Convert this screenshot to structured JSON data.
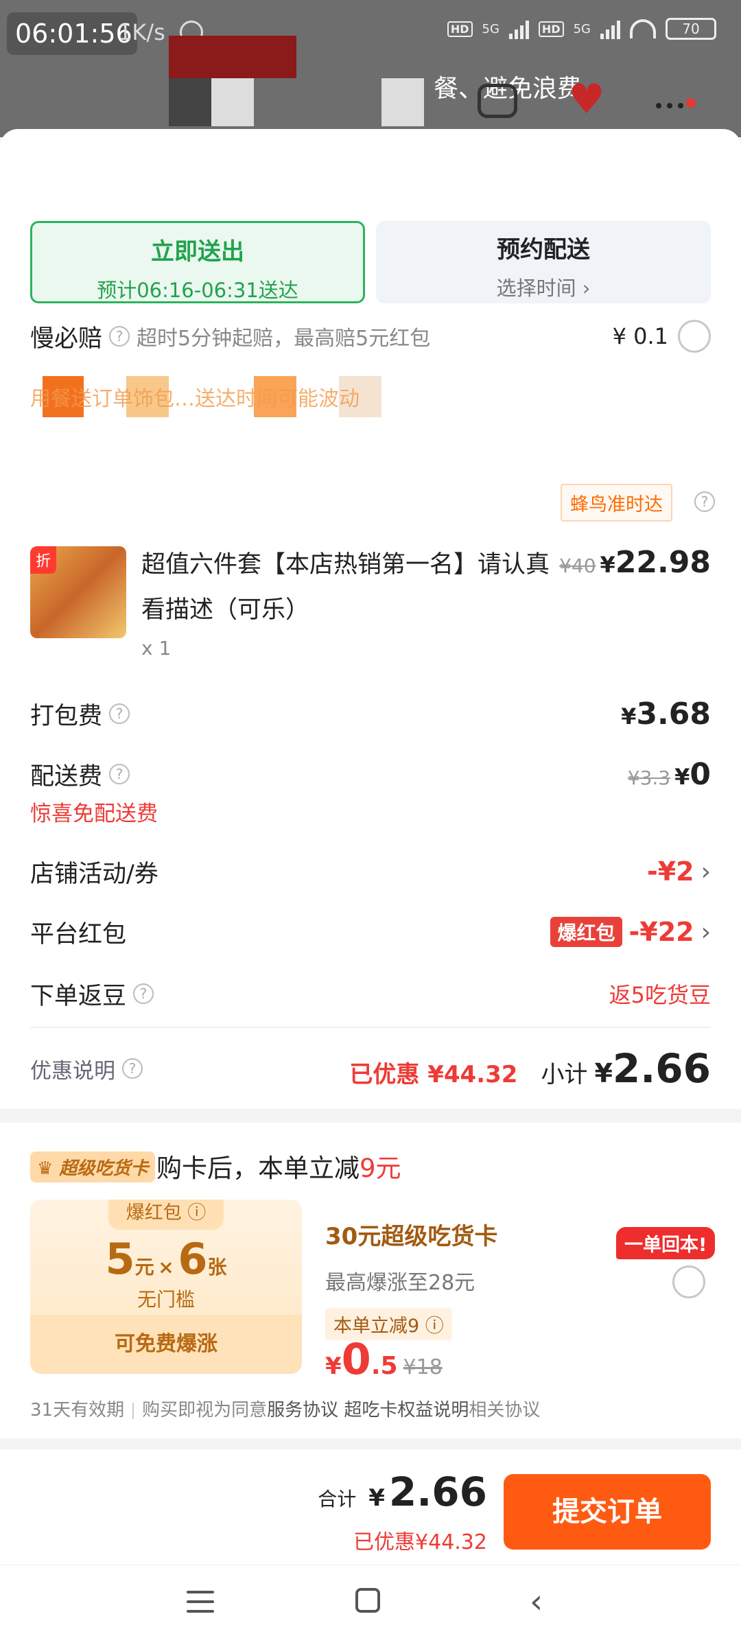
{
  "status_bar": {
    "time": "06:01:56",
    "netspeed": "1K/s",
    "battery": "70",
    "net1": "5G",
    "net2": "5G",
    "hd": "HD"
  },
  "header": {
    "title_fragment": "餐、避免浪费"
  },
  "delivery": {
    "now": {
      "label": "立即送出",
      "eta": "预计06:16-06:31送达"
    },
    "book": {
      "label": "预约配送",
      "sub": "选择时间 ›"
    }
  },
  "guarantee": {
    "label": "慢必赔",
    "desc": "超时5分钟起赔，最高赔5元红包",
    "price": "¥ 0.1"
  },
  "notice_faint": "用餐送订单饰包…送达时间可能波动",
  "ontime_badge": "蜂鸟准时达",
  "item": {
    "tag": "折",
    "title": "超值六件套【本店热销第一名】请认真看描述（可乐）",
    "qty": "x 1",
    "old_price": "¥40",
    "yen": "¥",
    "price": "22.98"
  },
  "fees": {
    "packing": {
      "label": "打包费",
      "yen": "¥",
      "value": "3.68"
    },
    "delivery": {
      "label": "配送费",
      "old": "¥3.3",
      "yen": "¥",
      "value": "0",
      "note": "惊喜免配送费"
    },
    "shop_coupon": {
      "label": "店铺活动/券",
      "value": "-¥2"
    },
    "platform": {
      "label": "平台红包",
      "tag": "爆红包",
      "value": "-¥22"
    },
    "beans": {
      "label": "下单返豆",
      "value": "返5吃货豆"
    }
  },
  "summary": {
    "label": "优惠说明",
    "saved": "已优惠 ¥44.32",
    "subtotal_label": "小计",
    "yen": "¥",
    "subtotal": "2.66"
  },
  "supercard": {
    "badge": "超级吃货卡",
    "title_prefix": "购卡后，本单立减",
    "title_amount": "9元",
    "coupon": {
      "tab": "爆红包",
      "amount1": "5",
      "unit1": "元",
      "times": "×",
      "amount2": "6",
      "unit2": "张",
      "nodoor": "无门槛",
      "bottom": "可免费爆涨"
    },
    "name": "30元超级吃货卡",
    "desc": "最高爆涨至28元",
    "cut": "本单立减9",
    "price_yen": "¥",
    "price_int": "0",
    "price_dec": ".5",
    "price_old": "¥18",
    "badge_one": "一单回本!",
    "terms": {
      "valid": "31天有效期",
      "agree": "购买即视为同意",
      "service": "服务协议",
      "rights": "超吃卡权益说明",
      "related": "相关协议"
    }
  },
  "footer": {
    "total_label": "合计",
    "yen": "¥",
    "total": "2.66",
    "saved": "已优惠¥44.32",
    "submit": "提交订单"
  }
}
